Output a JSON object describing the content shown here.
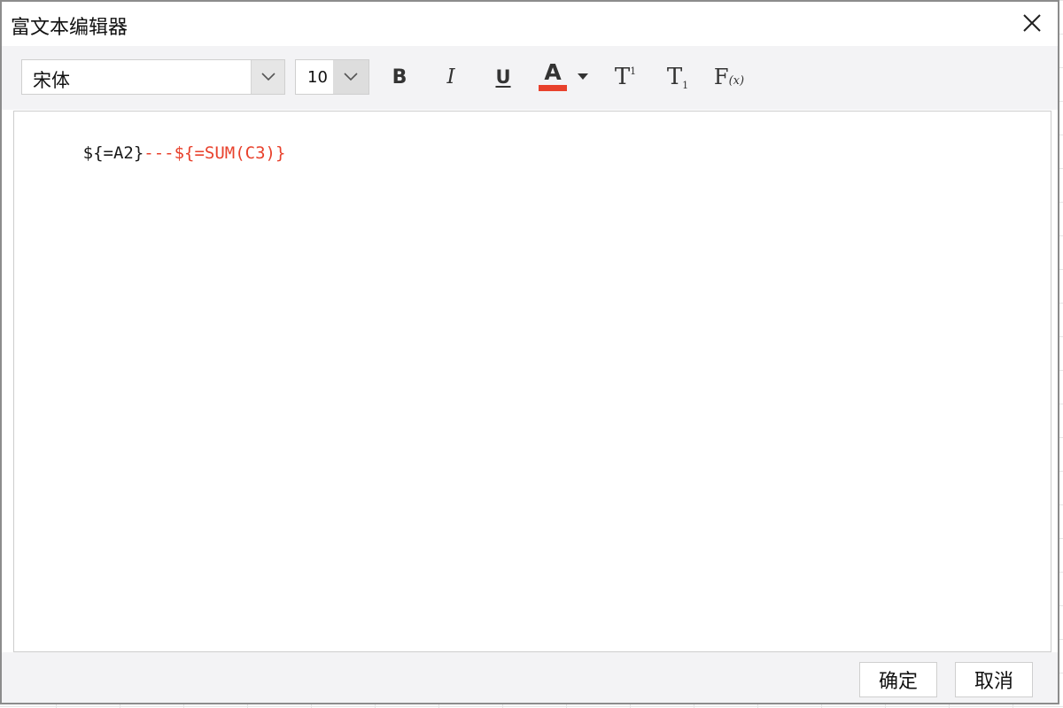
{
  "dialog": {
    "title": "富文本编辑器"
  },
  "toolbar": {
    "font_family_value": "宋体",
    "font_size_value": "10",
    "bold_label": "B",
    "italic_label": "I",
    "underline_label": "U",
    "font_color_label": "A",
    "font_color": "#e8412c",
    "superscript_label": "T",
    "superscript_mark": "1",
    "subscript_label": "T",
    "subscript_mark": "1",
    "formula_label": "F",
    "formula_mark": "(x)",
    "icons": [
      "chevron-down-icon",
      "bold-icon",
      "italic-icon",
      "underline-icon",
      "font-color-icon",
      "superscript-icon",
      "subscript-icon",
      "formula-icon",
      "close-icon"
    ]
  },
  "editor": {
    "segments": [
      {
        "text": "${=A2}",
        "color": "#1a1a1a"
      },
      {
        "text": "---${=SUM(C3)}",
        "color": "#e8412c"
      }
    ]
  },
  "footer": {
    "ok_label": "确定",
    "cancel_label": "取消"
  }
}
